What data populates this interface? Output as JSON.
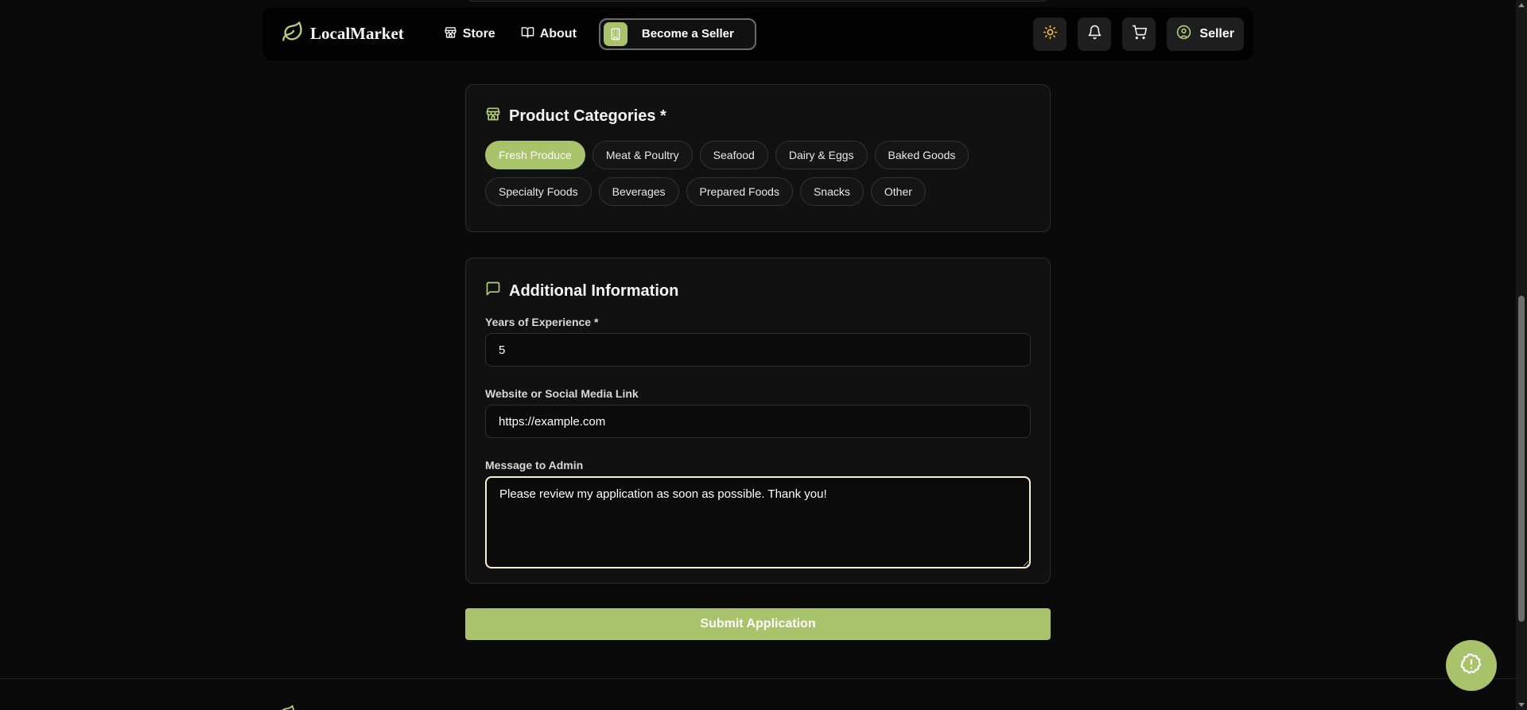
{
  "navbar": {
    "brand": "LocalMarket",
    "links": [
      {
        "label": "Store",
        "icon": "store-icon"
      },
      {
        "label": "About",
        "icon": "book-icon"
      }
    ],
    "cta_label": "Become a Seller",
    "profile_label": "Seller",
    "icons": [
      "sun-icon",
      "bell-icon",
      "cart-icon",
      "user-circle-icon"
    ]
  },
  "categories_card": {
    "title": "Product Categories *",
    "chips": [
      {
        "label": "Fresh Produce",
        "selected": true
      },
      {
        "label": "Meat & Poultry",
        "selected": false
      },
      {
        "label": "Seafood",
        "selected": false
      },
      {
        "label": "Dairy & Eggs",
        "selected": false
      },
      {
        "label": "Baked Goods",
        "selected": false
      },
      {
        "label": "Specialty Foods",
        "selected": false
      },
      {
        "label": "Beverages",
        "selected": false
      },
      {
        "label": "Prepared Foods",
        "selected": false
      },
      {
        "label": "Snacks",
        "selected": false
      },
      {
        "label": "Other",
        "selected": false
      }
    ]
  },
  "additional_card": {
    "title": "Additional Information",
    "experience_label": "Years of Experience *",
    "experience_value": "5",
    "website_label": "Website or Social Media Link",
    "website_value": "https://example.com",
    "message_label": "Message to Admin",
    "message_value": "Please review my application as soon as possible. Thank you!"
  },
  "submit_label": "Submit Application",
  "colors": {
    "accent": "#a8c36a",
    "background": "#0a0a0a",
    "card": "#111111",
    "focus_border": "#f1f3cf"
  }
}
